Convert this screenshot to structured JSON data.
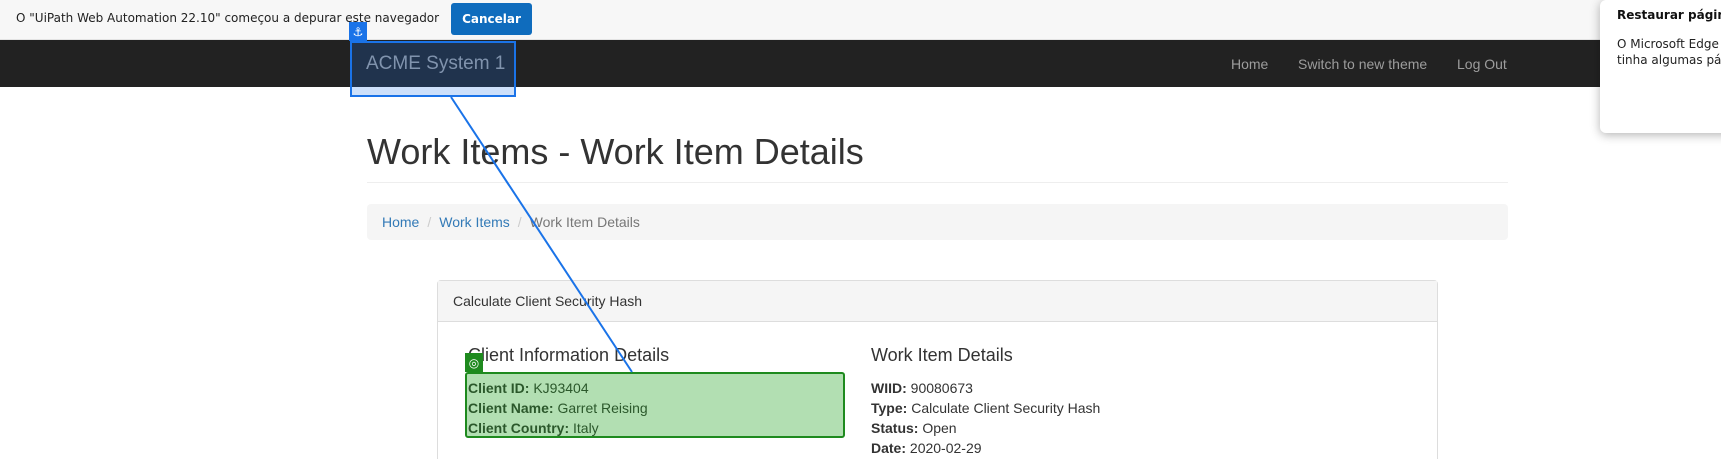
{
  "debug_banner": {
    "message": "O \"UiPath Web Automation 22.10\" começou a depurar este navegador",
    "cancel_label": "Cancelar"
  },
  "navbar": {
    "brand": "ACME System 1",
    "links": [
      "Home",
      "Switch to new theme",
      "Log Out"
    ]
  },
  "restore_popup": {
    "title": "Restaurar página",
    "body_line1": "O Microsoft Edge foi",
    "body_line2": "tinha algumas págin"
  },
  "page": {
    "title": "Work Items - Work Item Details",
    "breadcrumb": [
      "Home",
      "Work Items",
      "Work Item Details"
    ],
    "breadcrumb_sep": "/"
  },
  "panel": {
    "heading": "Calculate Client Security Hash",
    "client": {
      "title": "Client Information Details",
      "fields": [
        {
          "label": "Client ID:",
          "value": " KJ93404"
        },
        {
          "label": "Client Name:",
          "value": " Garret Reising"
        },
        {
          "label": "Client Country:",
          "value": " Italy"
        }
      ]
    },
    "work_item": {
      "title": "Work Item Details",
      "fields": [
        {
          "label": "WIID:",
          "value": " 90080673"
        },
        {
          "label": "Type:",
          "value": " Calculate Client Security Hash"
        },
        {
          "label": "Status:",
          "value": " Open"
        },
        {
          "label": "Date:",
          "value": " 2020-02-29"
        }
      ]
    }
  },
  "overlay": {
    "anchor_glyph": "⚓",
    "target_glyph": "◎",
    "anchor_color": "#1a73e8",
    "target_color": "#1e8a1e"
  }
}
